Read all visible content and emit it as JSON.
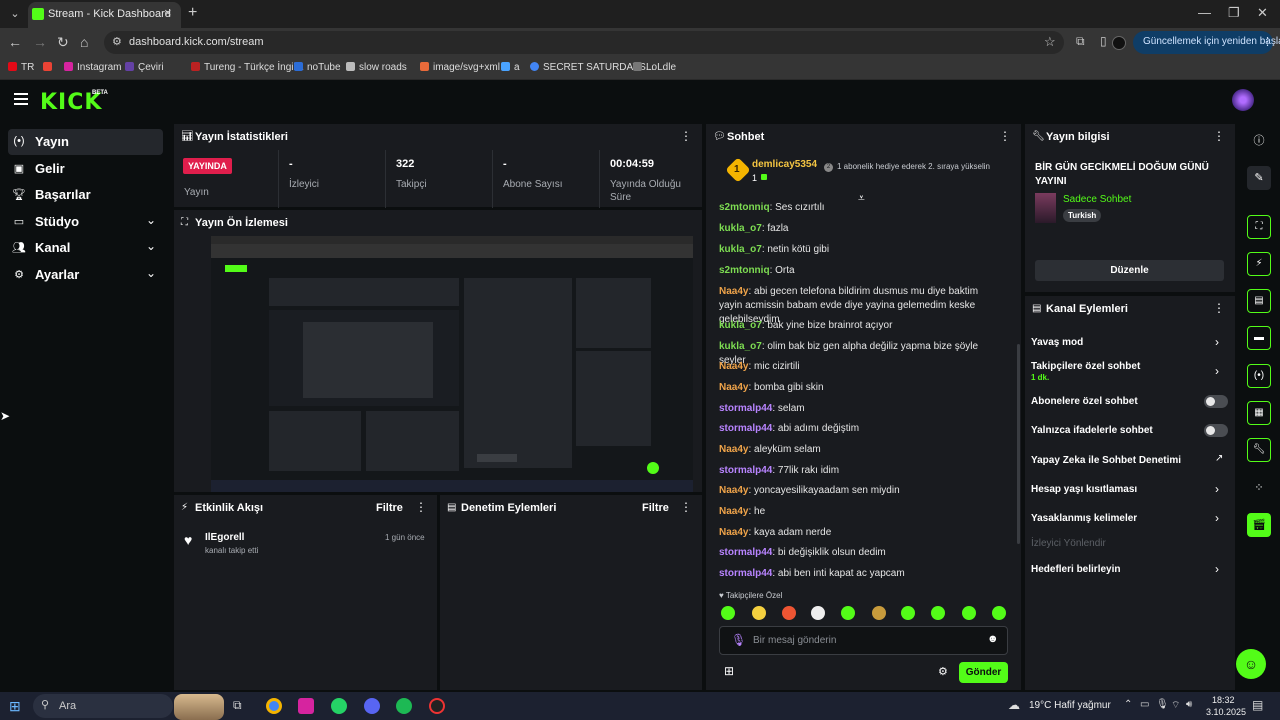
{
  "browser": {
    "tab_title": "Stream - Kick Dashboard",
    "url": "dashboard.kick.com/stream",
    "update_button": "Güncellemek için yeniden başlat",
    "bookmarks": [
      "TR",
      "Gmail",
      "Instagram",
      "Çeviri",
      "Tureng - Türkçe İngil...",
      "noTube",
      "slow roads",
      "image/svg+xml",
      "a",
      "SECRET SATURDAYS...",
      "LoLdle"
    ]
  },
  "brand": {
    "logo": "KICK",
    "beta": "BETA"
  },
  "nav": {
    "items": [
      {
        "label": "Yayın",
        "icon": "broadcast-icon"
      },
      {
        "label": "Gelir",
        "icon": "money-icon"
      },
      {
        "label": "Başarılar",
        "icon": "trophy-icon"
      },
      {
        "label": "Stüdyo",
        "icon": "studio-icon"
      },
      {
        "label": "Kanal",
        "icon": "people-icon"
      },
      {
        "label": "Ayarlar",
        "icon": "gear-icon"
      }
    ]
  },
  "stats": {
    "title": "Yayın İstatistikleri",
    "live_badge": "YAYINDA",
    "items": [
      {
        "value": "",
        "label": "Yayın"
      },
      {
        "value": "-",
        "label": "İzleyici"
      },
      {
        "value": "322",
        "label": "Takipçi"
      },
      {
        "value": "-",
        "label": "Abone Sayısı"
      },
      {
        "value": "00:04:59",
        "label": "Yayında Olduğu Süre"
      }
    ]
  },
  "preview": {
    "title": "Yayın Ön İzlemesi"
  },
  "activity": {
    "title": "Etkinlik Akışı",
    "filter": "Filtre",
    "events": [
      {
        "user": "IlEgorell",
        "text": "kanalı takip etti",
        "time": "1 gün önce"
      }
    ]
  },
  "moderation": {
    "title": "Denetim Eylemleri",
    "filter": "Filtre"
  },
  "chat": {
    "title": "Sohbet",
    "pinned": {
      "user": "demlicay5354",
      "count": "1",
      "badge": "1",
      "message": "1 abonelik hediye ederek 2. sıraya yükselin"
    },
    "messages": [
      {
        "user": "s2mtonniq",
        "text": "Ses cızırtılı",
        "color": "green"
      },
      {
        "user": "kukla_o7",
        "text": "fazla",
        "color": "green"
      },
      {
        "user": "kukla_o7",
        "text": "netin kötü gibi",
        "color": "green"
      },
      {
        "user": "s2mtonniq",
        "text": "Orta",
        "color": "green"
      },
      {
        "user": "Naa4y",
        "text": "abi gecen telefona bildirim dusmus mu diye baktim yayin acmissin babam evde diye yayina gelemedim keske gelebilseydim",
        "color": "orange"
      },
      {
        "user": "kukla_o7",
        "text": "bak yine bize brainrot açıyor",
        "color": "green"
      },
      {
        "user": "kukla_o7",
        "text": "olim bak biz gen alpha değiliz yapma bize şöyle şeyler",
        "color": "green"
      },
      {
        "user": "Naa4y",
        "text": "mic cizirtili",
        "color": "orange"
      },
      {
        "user": "Naa4y",
        "text": "bomba gibi skin",
        "color": "orange"
      },
      {
        "user": "stormalp44",
        "text": "selam",
        "color": "purple"
      },
      {
        "user": "stormalp44",
        "text": "abi adımı değiştim",
        "color": "purple"
      },
      {
        "user": "Naa4y",
        "text": "aleyküm selam",
        "color": "orange"
      },
      {
        "user": "stormalp44",
        "text": "77lik rakı idim",
        "color": "purple"
      },
      {
        "user": "Naa4y",
        "text": "yoncayesilikayaadam sen miydin",
        "color": "orange"
      },
      {
        "user": "Naa4y",
        "text": "he",
        "color": "orange"
      },
      {
        "user": "Naa4y",
        "text": "kaya adam nerde",
        "color": "orange"
      },
      {
        "user": "stormalp44",
        "text": "bi değişiklik olsun dedim",
        "color": "purple"
      },
      {
        "user": "stormalp44",
        "text": "abi ben inti kapat ac yapcam",
        "color": "purple"
      }
    ],
    "followers_only": "Takipçilere Özel",
    "input_placeholder": "Bir mesaj gönderin",
    "send": "Gönder"
  },
  "stream_info": {
    "title": "Yayın bilgisi",
    "stream_title": "BİR GÜN GECİKMELİ DOĞUM GÜNÜ YAYINI",
    "category": "Sadece Sohbet",
    "tag": "Turkish",
    "edit": "Düzenle"
  },
  "channel_actions": {
    "title": "Kanal Eylemleri",
    "rows": [
      {
        "label": "Yavaş mod",
        "control": "chevron"
      },
      {
        "label": "Takipçilere özel sohbet",
        "sub": "1 dk.",
        "control": "chevron"
      },
      {
        "label": "Abonelere özel sohbet",
        "control": "toggle"
      },
      {
        "label": "Yalnızca ifadelerle sohbet",
        "control": "toggle"
      },
      {
        "label": "Yapay Zeka ile Sohbet Denetimi",
        "control": "external"
      },
      {
        "label": "Hesap yaşı kısıtlaması",
        "control": "chevron"
      },
      {
        "label": "Yasaklanmış kelimeler",
        "control": "chevron"
      },
      {
        "label": "İzleyici Yönlendir",
        "control": "none"
      },
      {
        "label": "Hedefleri belirleyin",
        "control": "chevron"
      }
    ]
  },
  "taskbar": {
    "search": "Ara",
    "weather": "19°C  Hafif yağmur",
    "time": "18:32",
    "date": "3.10.2025"
  },
  "colors": {
    "kick_green": "#53fc18",
    "live_red": "#e01e4c",
    "panel": "#191b1f",
    "bg": "#0b0e0f"
  }
}
